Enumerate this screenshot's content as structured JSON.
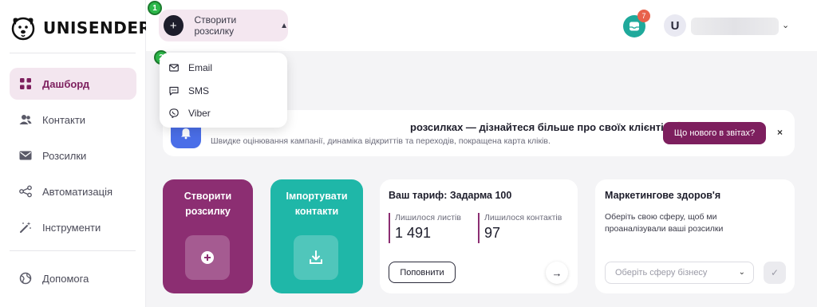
{
  "brand": {
    "name": "UNISENDER"
  },
  "sidebar": {
    "items": [
      {
        "label": "Дашборд",
        "icon": "dashboard-icon",
        "active": true
      },
      {
        "label": "Контакти",
        "icon": "contacts-icon"
      },
      {
        "label": "Розсилки",
        "icon": "mail-icon"
      },
      {
        "label": "Автоматизація",
        "icon": "automation-icon"
      },
      {
        "label": "Інструменти",
        "icon": "magic-wand-icon"
      }
    ],
    "help": {
      "label": "Допомога",
      "icon": "globe-icon"
    }
  },
  "topbar": {
    "create_label": "Створити розсилку",
    "notifications_count": "7",
    "avatar_letter": "U"
  },
  "steps": {
    "first": "1",
    "second": "2"
  },
  "dropdown": {
    "items": [
      {
        "label": "Email",
        "icon": "email-icon"
      },
      {
        "label": "SMS",
        "icon": "sms-icon"
      },
      {
        "label": "Viber",
        "icon": "viber-icon"
      }
    ]
  },
  "banner": {
    "title": "розсилках — дізнайтеся більше про своїх клієнтів 🙂",
    "subtitle": "Швидке оцінювання кампанії, динаміка відкриттів та переходів, покращена карта кліків.",
    "button_label": "Що нового в звітах?",
    "close_label": "×"
  },
  "cards": {
    "create": {
      "title_line1": "Створити",
      "title_line2": "розсилку"
    },
    "import": {
      "title_line1": "Імпортувати",
      "title_line2": "контакти"
    },
    "tariff": {
      "title": "Ваш тариф: Задарма 100",
      "letters_label": "Лишилося листів",
      "letters_value": "1 491",
      "contacts_label": "Лишилося контактів",
      "contacts_value": "97",
      "button_label": "Поповнити"
    },
    "health": {
      "title": "Маркетингове здоров'я",
      "text": "Оберіть свою сферу, щоб ми проаналізували ваші розсилки",
      "select_placeholder": "Оберіть сферу бізнесу"
    }
  },
  "colors": {
    "accent": "#7d1f5e",
    "teal": "#1fb7a8",
    "purple_card": "#8c2e72",
    "badge": "#e8614b",
    "step": "#2db84a"
  }
}
